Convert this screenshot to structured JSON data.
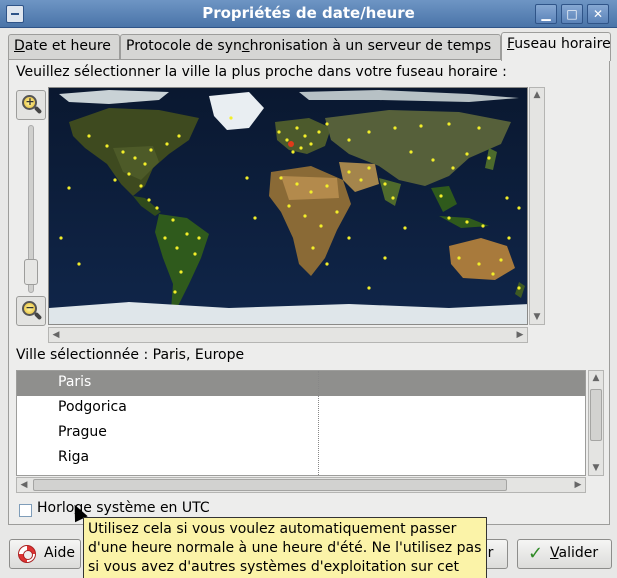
{
  "window": {
    "title": "Propriétés de date/heure",
    "buttons": {
      "minimize": "▁",
      "maximize": "□",
      "close": "✕"
    }
  },
  "tabs": [
    {
      "prefix": "",
      "mnemonic": "D",
      "rest": "ate et heure"
    },
    {
      "prefix": "Protocole de syn",
      "mnemonic": "c",
      "rest": "hronisation à un serveur de temps"
    },
    {
      "prefix": "",
      "mnemonic": "F",
      "rest": "useau horaire"
    }
  ],
  "timezone": {
    "prompt": "Veuillez sélectionner la ville la plus proche dans votre fuseau horaire :",
    "selected_label": "Ville sélectionnée : Paris, Europe",
    "cities": [
      "Paris",
      "Podgorica",
      "Prague",
      "Riga"
    ],
    "selected_index": 0
  },
  "zoom": {
    "in_symbol": "+",
    "out_symbol": "−"
  },
  "utc": {
    "label_prefix": "Horlo",
    "label_mnemonic": "g",
    "label_rest": "e système en UTC",
    "checked": false
  },
  "tooltip": {
    "lines": [
      "Utilisez cela si vous voulez automatiquement passer",
      "d'une heure normale à une heure d'été. Ne l'utilisez pas",
      "si vous avez d'autres systèmes d'exploitation sur cet"
    ]
  },
  "buttons": {
    "help": "Aide",
    "cancel_visible_fragment": "er",
    "ok_mnemonic": "V",
    "ok_rest": "alider"
  },
  "colors": {
    "titlebar": "#4a74a8",
    "city_dot": "#f2ee2a",
    "selected_city_dot": "#e03a1a",
    "tooltip_bg": "#fbf3a8",
    "list_selection": "#8f8f8d"
  },
  "icons": {
    "zoom_in": "zoom-in-icon",
    "zoom_out": "zoom-out-icon",
    "help": "lifebuoy-icon",
    "ok": "checkmark-icon"
  }
}
